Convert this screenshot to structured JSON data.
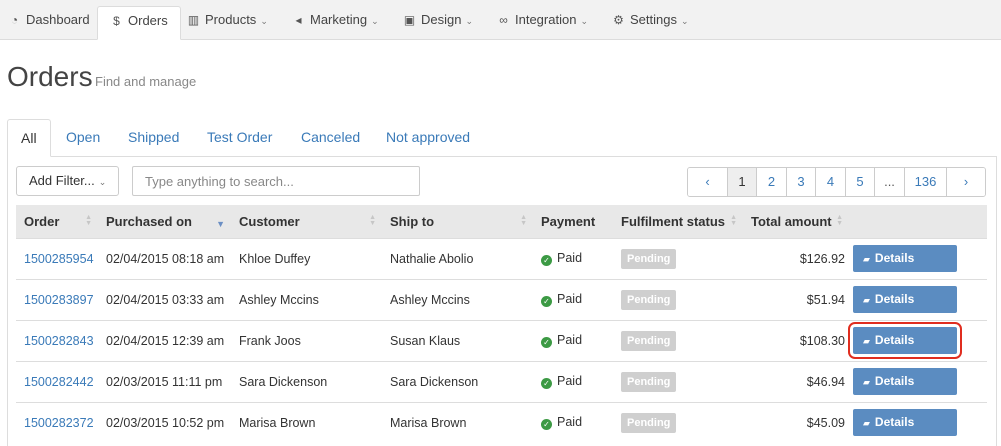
{
  "nav": {
    "items": [
      {
        "label": "Dashboard",
        "icon": "dashboard-icon",
        "glyph": "◔",
        "dropdown": false,
        "active": false
      },
      {
        "label": "Orders",
        "icon": "dollar-icon",
        "glyph": "$",
        "dropdown": false,
        "active": true
      },
      {
        "label": "Products",
        "icon": "barcode-icon",
        "glyph": "▥",
        "dropdown": true,
        "active": false
      },
      {
        "label": "Marketing",
        "icon": "megaphone-icon",
        "glyph": "◂",
        "dropdown": true,
        "active": false
      },
      {
        "label": "Design",
        "icon": "picture-icon",
        "glyph": "▣",
        "dropdown": true,
        "active": false
      },
      {
        "label": "Integration",
        "icon": "link-icon",
        "glyph": "∞",
        "dropdown": true,
        "active": false
      },
      {
        "label": "Settings",
        "icon": "gears-icon",
        "glyph": "⚙",
        "dropdown": true,
        "active": false
      }
    ],
    "caret": "⌄"
  },
  "page": {
    "title": "Orders",
    "subtitle": "Find and manage"
  },
  "tabs": [
    "All",
    "Open",
    "Shipped",
    "Test Order",
    "Canceled",
    "Not approved"
  ],
  "filter": {
    "add_filter_label": "Add Filter...",
    "caret": "⌄",
    "search_placeholder": "Type anything to search..."
  },
  "pagination": {
    "prev": "‹",
    "pages": [
      "1",
      "2",
      "3",
      "4",
      "5",
      "...",
      "136"
    ],
    "next": "›",
    "current": "1"
  },
  "table": {
    "columns": [
      "Order",
      "Purchased on",
      "Customer",
      "Ship to",
      "Payment",
      "Fulfilment status",
      "Total amount",
      ""
    ],
    "sorted_column": "Purchased on",
    "rows": [
      {
        "order": "1500285954",
        "purchased": "02/04/2015 08:18 am",
        "customer": "Khloe Duffey",
        "ship_to": "Nathalie Abolio",
        "payment": "Paid",
        "status": "Pending",
        "total": "$126.92",
        "action": "Details",
        "highlighted": false
      },
      {
        "order": "1500283897",
        "purchased": "02/04/2015 03:33 am",
        "customer": "Ashley Mccins",
        "ship_to": "Ashley Mccins",
        "payment": "Paid",
        "status": "Pending",
        "total": "$51.94",
        "action": "Details",
        "highlighted": false
      },
      {
        "order": "1500282843",
        "purchased": "02/04/2015 12:39 am",
        "customer": "Frank Joos",
        "ship_to": "Susan Klaus",
        "payment": "Paid",
        "status": "Pending",
        "total": "$108.30",
        "action": "Details",
        "highlighted": true
      },
      {
        "order": "1500282442",
        "purchased": "02/03/2015 11:11 pm",
        "customer": "Sara Dickenson",
        "ship_to": "Sara Dickenson",
        "payment": "Paid",
        "status": "Pending",
        "total": "$46.94",
        "action": "Details",
        "highlighted": false
      },
      {
        "order": "1500282372",
        "purchased": "02/03/2015 10:52 pm",
        "customer": "Marisa Brown",
        "ship_to": "Marisa Brown",
        "payment": "Paid",
        "status": "Pending",
        "total": "$45.09",
        "action": "Details",
        "highlighted": false
      }
    ]
  },
  "colors": {
    "link": "#3a7ab8",
    "details_button": "#5b8cc1",
    "paid": "#3c9a44",
    "pending_badge": "#cfcfcf",
    "highlight_outline": "#e02d1f",
    "header_bg": "#e8e8e8",
    "nav_bg": "#f2f2f2"
  }
}
